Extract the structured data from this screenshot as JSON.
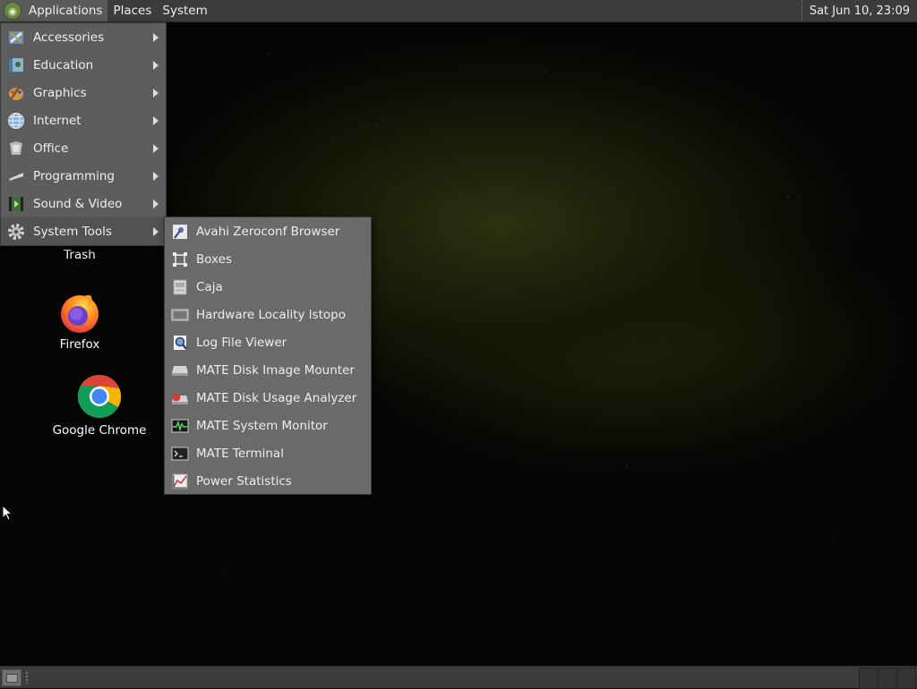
{
  "top_panel": {
    "menus": [
      "Applications",
      "Places",
      "System"
    ],
    "clock": "Sat Jun 10, 23:09"
  },
  "applications_menu": {
    "items": [
      {
        "label": "Accessories",
        "icon": "accessories-icon"
      },
      {
        "label": "Education",
        "icon": "education-icon"
      },
      {
        "label": "Graphics",
        "icon": "graphics-icon"
      },
      {
        "label": "Internet",
        "icon": "internet-icon"
      },
      {
        "label": "Office",
        "icon": "office-icon"
      },
      {
        "label": "Programming",
        "icon": "programming-icon"
      },
      {
        "label": "Sound & Video",
        "icon": "sound-video-icon"
      },
      {
        "label": "System Tools",
        "icon": "gear-icon",
        "active": true
      }
    ]
  },
  "system_tools_menu": {
    "items": [
      {
        "label": "Avahi Zeroconf Browser",
        "icon": "avahi-icon"
      },
      {
        "label": "Boxes",
        "icon": "boxes-icon"
      },
      {
        "label": "Caja",
        "icon": "caja-icon"
      },
      {
        "label": "Hardware Locality lstopo",
        "icon": "lstopo-icon"
      },
      {
        "label": "Log File Viewer",
        "icon": "log-viewer-icon"
      },
      {
        "label": "MATE Disk Image Mounter",
        "icon": "disk-mounter-icon"
      },
      {
        "label": "MATE Disk Usage Analyzer",
        "icon": "disk-usage-icon"
      },
      {
        "label": "MATE System Monitor",
        "icon": "system-monitor-icon"
      },
      {
        "label": "MATE Terminal",
        "icon": "terminal-icon"
      },
      {
        "label": "Power Statistics",
        "icon": "power-statistics-icon"
      }
    ]
  },
  "desktop": {
    "icons": [
      {
        "label": "Trash",
        "icon": "trash-icon"
      },
      {
        "label": "Firefox",
        "icon": "firefox-icon"
      },
      {
        "label": "Google Chrome",
        "icon": "chrome-icon"
      }
    ]
  }
}
